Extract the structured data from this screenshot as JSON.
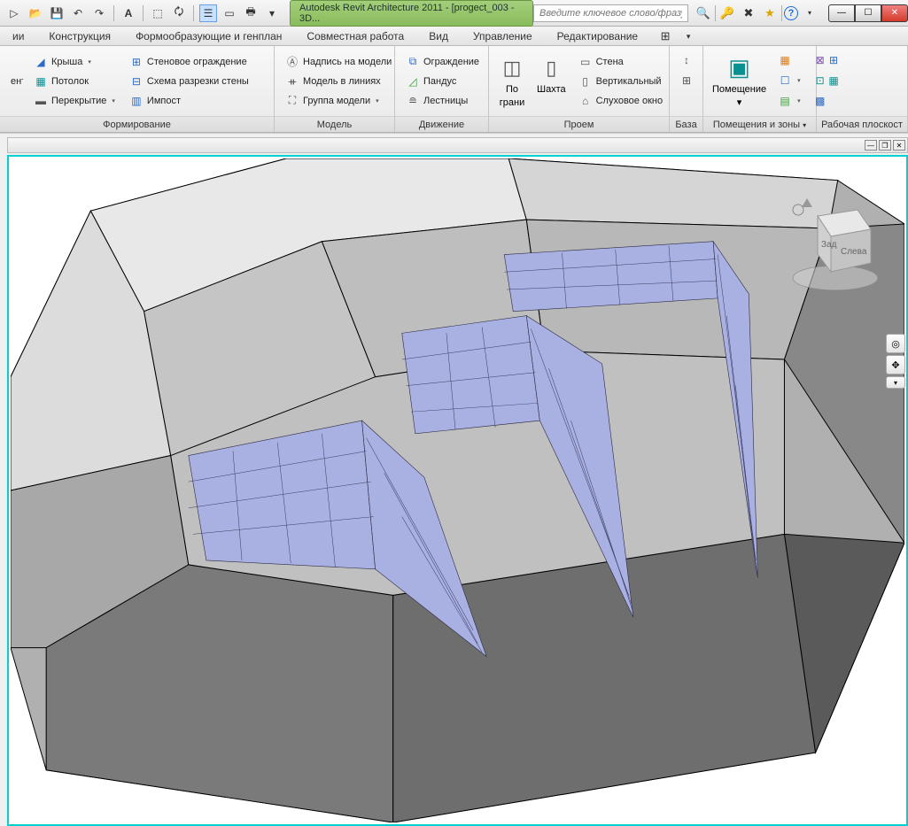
{
  "titlebar": {
    "doc_title": "Autodesk Revit Architecture 2011 - [progect_003 - 3D...",
    "search_placeholder": "Введите ключевое слово/фразу"
  },
  "menu": {
    "tabs": [
      "ии",
      "Конструкция",
      "Формообразующие и генплан",
      "Совместная работа",
      "Вид",
      "Управление",
      "Редактирование"
    ]
  },
  "ribbon": {
    "panel0": {
      "title": "Формирование",
      "truncated": "ент",
      "roof": "Крыша",
      "ceiling": "Потолок",
      "floor": "Перекрытие",
      "curtain_system": "Стеновое ограждение",
      "curtain_grid": "Схема разрезки стены",
      "mullion": "Импост"
    },
    "panel1": {
      "title": "Модель",
      "model_text": "Надпись на модели",
      "model_line": "Модель в линиях",
      "model_group": "Группа модели"
    },
    "panel2": {
      "title": "Движение",
      "railing": "Ограждение",
      "ramp": "Пандус",
      "stairs": "Лестницы"
    },
    "panel3": {
      "title": "Проем",
      "by_face_1": "По",
      "by_face_2": "грани",
      "shaft": "Шахта",
      "wall_opening": "Стена",
      "vertical": "Вертикальный",
      "dormer": "Слуховое окно"
    },
    "panel4": {
      "title": "База"
    },
    "panel5": {
      "title": "Помещения и зоны",
      "room": "Помещение"
    },
    "panel6": {
      "title": "Рабочая плоскост"
    }
  },
  "viewcube": {
    "back": "Зад",
    "left": "Слева"
  }
}
